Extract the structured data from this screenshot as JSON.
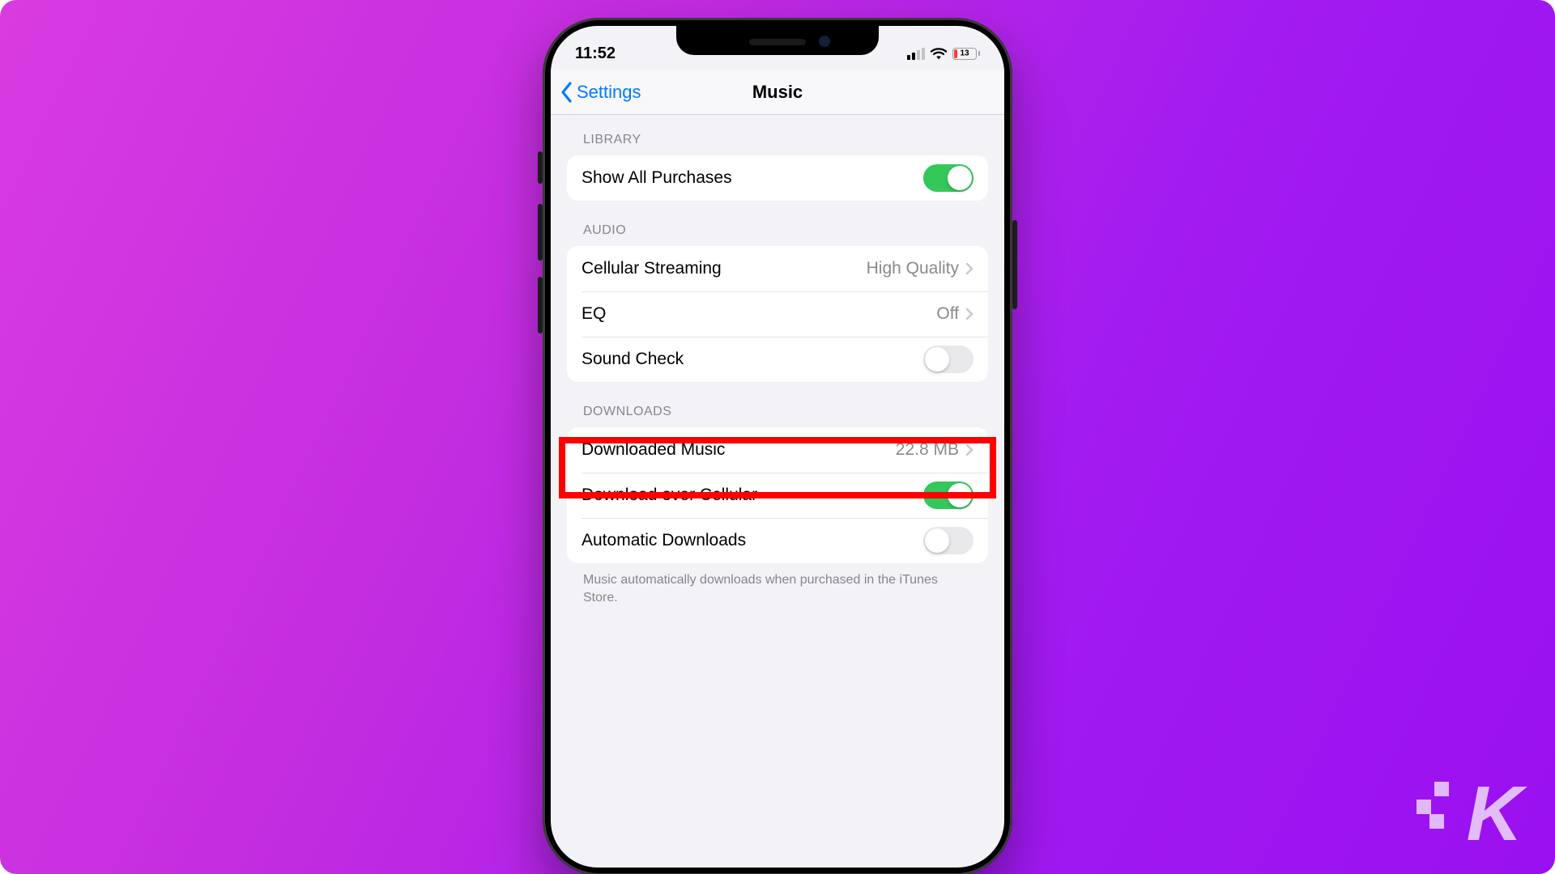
{
  "statusbar": {
    "time": "11:52",
    "battery_pct": "13"
  },
  "navbar": {
    "back_label": "Settings",
    "title": "Music"
  },
  "sections": {
    "library": {
      "header": "LIBRARY",
      "show_all_purchases": {
        "label": "Show All Purchases",
        "on": true
      }
    },
    "audio": {
      "header": "AUDIO",
      "cellular_streaming": {
        "label": "Cellular Streaming",
        "value": "High Quality"
      },
      "eq": {
        "label": "EQ",
        "value": "Off"
      },
      "sound_check": {
        "label": "Sound Check",
        "on": false
      }
    },
    "downloads": {
      "header": "DOWNLOADS",
      "downloaded_music": {
        "label": "Downloaded Music",
        "value": "22.8 MB"
      },
      "download_over_cellular": {
        "label": "Download over Cellular",
        "on": true
      },
      "automatic_downloads": {
        "label": "Automatic Downloads",
        "on": false
      },
      "footer": "Music automatically downloads when purchased in the iTunes Store."
    }
  },
  "watermark": "K"
}
